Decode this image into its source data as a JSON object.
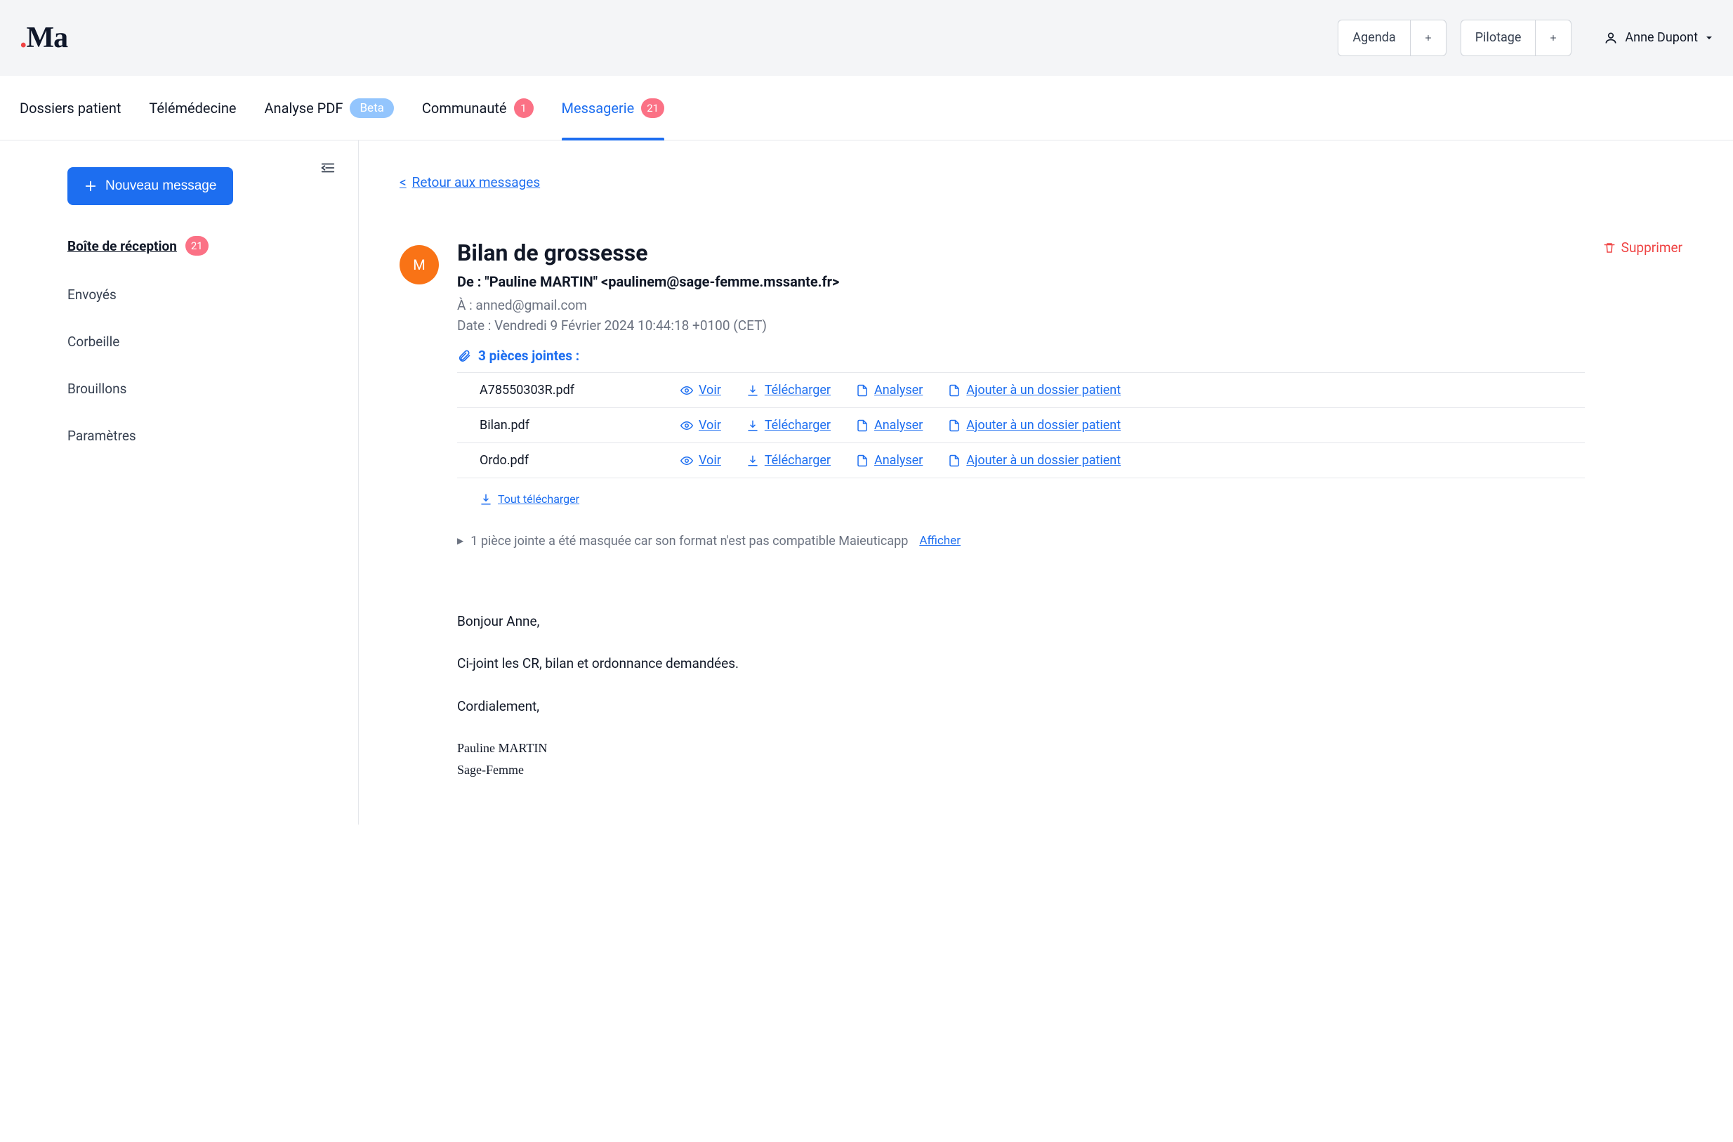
{
  "header": {
    "logo_text": "Ma",
    "agenda_label": "Agenda",
    "pilotage_label": "Pilotage",
    "user_name": "Anne Dupont"
  },
  "tabs": {
    "dossiers": "Dossiers patient",
    "telemedecine": "Télémédecine",
    "analyse_pdf": "Analyse PDF",
    "analyse_pdf_badge": "Beta",
    "communaute": "Communauté",
    "communaute_badge": "1",
    "messagerie": "Messagerie",
    "messagerie_badge": "21"
  },
  "sidebar": {
    "new_message": "Nouveau message",
    "inbox": "Boîte de réception",
    "inbox_badge": "21",
    "sent": "Envoyés",
    "trash": "Corbeille",
    "drafts": "Brouillons",
    "settings": "Paramètres"
  },
  "message": {
    "back": "Retour aux messages",
    "avatar_initial": "M",
    "subject": "Bilan de grossesse",
    "from_prefix": "De : ",
    "from_value": "\"Pauline MARTIN\" <paulinem@sage-femme.mssante.fr>",
    "to_prefix": "À : ",
    "to_value": "anned@gmail.com",
    "date_prefix": "Date : ",
    "date_value": "Vendredi 9 Février 2024 10:44:18 +0100 (CET)",
    "delete": "Supprimer",
    "attach_label": "3 pièces jointes :",
    "attachments": [
      {
        "name": "A78550303R.pdf"
      },
      {
        "name": "Bilan.pdf"
      },
      {
        "name": "Ordo.pdf"
      }
    ],
    "actions": {
      "view": "Voir",
      "download": "Télécharger",
      "analyze": "Analyser",
      "add_to_patient": "Ajouter à un dossier patient",
      "download_all": "Tout télécharger"
    },
    "hidden_note": "1 pièce jointe a été masquée car son format n'est pas compatible Maieuticapp",
    "show": "Afficher",
    "body_p1": "Bonjour Anne,",
    "body_p2": "Ci-joint les CR, bilan et ordonnance demandées.",
    "body_p3": "Cordialement,",
    "signature_name": "Pauline MARTIN",
    "signature_title": "Sage-Femme"
  }
}
